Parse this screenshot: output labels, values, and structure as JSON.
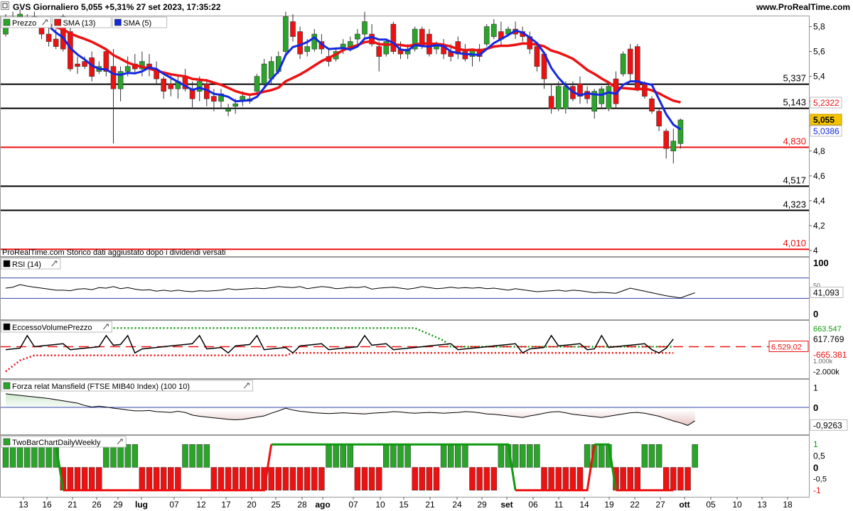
{
  "header": {
    "title": "GVS Giornaliero 5,055 +5,31% 27 set 2023, 17:35:22",
    "site": "www.ProRealTime.com"
  },
  "colors": {
    "up": "#2aa52a",
    "down": "#ee1111",
    "sma13": "#ee1111",
    "sma5": "#1428e0",
    "level_red": "#ee1111",
    "level_black": "#000000"
  },
  "chart_data": [
    {
      "type": "candlestick",
      "panel": "price",
      "title_badges": [
        "Prezzo",
        "SMA (13)",
        "SMA (5)"
      ],
      "note": "ProRealTime.com Storico dati aggiustato dopo i dividendi versati",
      "y_ticks": [
        "5,8",
        "5,6",
        "5,4",
        "5,2",
        "5",
        "4,8",
        "4,6",
        "4,4",
        "4,2",
        "4"
      ],
      "ylim": [
        4.0,
        5.9
      ],
      "levels": [
        {
          "value": 5.337,
          "label": "5,337",
          "color": "black"
        },
        {
          "value": 5.143,
          "label": "5,143",
          "color": "black"
        },
        {
          "value": 4.83,
          "label": "4,830",
          "color": "red"
        },
        {
          "value": 4.517,
          "label": "4,517",
          "color": "black"
        },
        {
          "value": 4.323,
          "label": "4,323",
          "color": "black"
        },
        {
          "value": 4.01,
          "label": "4,010",
          "color": "red"
        }
      ],
      "last_labels": [
        {
          "value": 5.2322,
          "label": "5,2322",
          "color": "#ee1111"
        },
        {
          "value": 5.055,
          "label": "5,055",
          "color": "#f5c400"
        },
        {
          "value": 5.0386,
          "label": "5,0386",
          "color": "#1428e0"
        }
      ],
      "candles": [
        [
          5.74,
          5.9,
          5.72,
          5.86
        ],
        [
          5.87,
          5.92,
          5.82,
          5.85
        ],
        [
          5.88,
          5.94,
          5.84,
          5.9
        ],
        [
          5.86,
          5.9,
          5.8,
          5.82
        ],
        [
          5.84,
          5.92,
          5.82,
          5.88
        ],
        [
          5.86,
          5.88,
          5.7,
          5.74
        ],
        [
          5.74,
          5.8,
          5.64,
          5.68
        ],
        [
          5.7,
          5.78,
          5.62,
          5.64
        ],
        [
          5.88,
          5.9,
          5.6,
          5.62
        ],
        [
          5.76,
          5.8,
          5.44,
          5.46
        ],
        [
          5.5,
          5.56,
          5.42,
          5.48
        ],
        [
          5.52,
          5.56,
          5.46,
          5.48
        ],
        [
          5.55,
          5.6,
          5.36,
          5.4
        ],
        [
          5.44,
          5.52,
          5.42,
          5.48
        ],
        [
          5.6,
          5.62,
          5.4,
          5.44
        ],
        [
          5.48,
          5.62,
          4.86,
          5.3
        ],
        [
          5.3,
          5.48,
          5.2,
          5.44
        ],
        [
          5.44,
          5.56,
          5.4,
          5.48
        ],
        [
          5.5,
          5.58,
          5.42,
          5.46
        ],
        [
          5.46,
          5.6,
          5.4,
          5.52
        ],
        [
          5.5,
          5.58,
          5.4,
          5.46
        ],
        [
          5.44,
          5.52,
          5.34,
          5.38
        ],
        [
          5.38,
          5.4,
          5.22,
          5.28
        ],
        [
          5.34,
          5.42,
          5.24,
          5.3
        ],
        [
          5.3,
          5.4,
          5.22,
          5.36
        ],
        [
          5.4,
          5.46,
          5.28,
          5.3
        ],
        [
          5.3,
          5.36,
          5.14,
          5.22
        ],
        [
          5.28,
          5.4,
          5.2,
          5.36
        ],
        [
          5.34,
          5.38,
          5.16,
          5.22
        ],
        [
          5.24,
          5.3,
          5.12,
          5.2
        ],
        [
          5.2,
          5.3,
          5.14,
          5.26
        ],
        [
          5.12,
          5.18,
          5.08,
          5.14
        ],
        [
          5.16,
          5.22,
          5.1,
          5.18
        ],
        [
          5.2,
          5.28,
          5.16,
          5.24
        ],
        [
          5.2,
          5.26,
          5.18,
          5.22
        ],
        [
          5.28,
          5.42,
          5.26,
          5.4
        ],
        [
          5.34,
          5.54,
          5.32,
          5.5
        ],
        [
          5.38,
          5.56,
          5.34,
          5.52
        ],
        [
          5.44,
          5.6,
          5.42,
          5.56
        ],
        [
          5.6,
          5.92,
          5.58,
          5.88
        ],
        [
          5.84,
          5.9,
          5.68,
          5.72
        ],
        [
          5.76,
          5.8,
          5.54,
          5.58
        ],
        [
          5.6,
          5.7,
          5.56,
          5.64
        ],
        [
          5.62,
          5.78,
          5.6,
          5.74
        ],
        [
          5.68,
          5.74,
          5.58,
          5.62
        ],
        [
          5.56,
          5.62,
          5.48,
          5.52
        ],
        [
          5.54,
          5.62,
          5.52,
          5.6
        ],
        [
          5.62,
          5.7,
          5.58,
          5.66
        ],
        [
          5.64,
          5.72,
          5.6,
          5.68
        ],
        [
          5.7,
          5.78,
          5.66,
          5.74
        ],
        [
          5.74,
          5.92,
          5.7,
          5.84
        ],
        [
          5.74,
          5.82,
          5.64,
          5.66
        ],
        [
          5.64,
          5.68,
          5.44,
          5.56
        ],
        [
          5.58,
          5.7,
          5.56,
          5.68
        ],
        [
          5.82,
          5.84,
          5.58,
          5.6
        ],
        [
          5.62,
          5.68,
          5.54,
          5.58
        ],
        [
          5.58,
          5.66,
          5.54,
          5.62
        ],
        [
          5.62,
          5.8,
          5.6,
          5.78
        ],
        [
          5.78,
          5.8,
          5.62,
          5.64
        ],
        [
          5.74,
          5.78,
          5.56,
          5.58
        ],
        [
          5.62,
          5.68,
          5.58,
          5.64
        ],
        [
          5.64,
          5.7,
          5.54,
          5.58
        ],
        [
          5.6,
          5.66,
          5.52,
          5.56
        ],
        [
          5.68,
          5.72,
          5.54,
          5.58
        ],
        [
          5.6,
          5.66,
          5.52,
          5.54
        ],
        [
          5.56,
          5.62,
          5.48,
          5.62
        ],
        [
          5.62,
          5.66,
          5.52,
          5.56
        ],
        [
          5.66,
          5.82,
          5.64,
          5.8
        ],
        [
          5.72,
          5.86,
          5.7,
          5.82
        ],
        [
          5.76,
          5.84,
          5.64,
          5.7
        ],
        [
          5.74,
          5.8,
          5.72,
          5.78
        ],
        [
          5.78,
          5.84,
          5.7,
          5.74
        ],
        [
          5.76,
          5.8,
          5.68,
          5.72
        ],
        [
          5.72,
          5.76,
          5.58,
          5.62
        ],
        [
          5.64,
          5.66,
          5.44,
          5.48
        ],
        [
          5.58,
          5.6,
          5.3,
          5.38
        ],
        [
          5.24,
          5.34,
          5.1,
          5.14
        ],
        [
          5.14,
          5.36,
          5.12,
          5.32
        ],
        [
          5.14,
          5.36,
          5.1,
          5.32
        ],
        [
          5.32,
          5.36,
          5.2,
          5.22
        ],
        [
          5.34,
          5.4,
          5.18,
          5.24
        ],
        [
          5.28,
          5.32,
          5.18,
          5.22
        ],
        [
          5.12,
          5.3,
          5.06,
          5.28
        ],
        [
          5.18,
          5.32,
          5.14,
          5.3
        ],
        [
          5.14,
          5.36,
          5.12,
          5.32
        ],
        [
          5.38,
          5.44,
          5.14,
          5.18
        ],
        [
          5.42,
          5.6,
          5.4,
          5.58
        ],
        [
          5.62,
          5.66,
          5.36,
          5.42
        ],
        [
          5.64,
          5.66,
          5.28,
          5.3
        ],
        [
          5.34,
          5.36,
          5.22,
          5.24
        ],
        [
          5.22,
          5.24,
          5.1,
          5.12
        ],
        [
          5.12,
          5.14,
          4.96,
          5.0
        ],
        [
          4.96,
          4.98,
          4.74,
          4.82
        ],
        [
          4.8,
          4.98,
          4.7,
          4.88
        ],
        [
          4.86,
          5.06,
          4.82,
          5.05
        ]
      ]
    },
    {
      "type": "line",
      "panel": "rsi",
      "title_badges": [
        "RSI (14)"
      ],
      "y_ticks": [
        "100",
        "50",
        "41,093",
        "0"
      ],
      "ylim": [
        0,
        100
      ],
      "bands": [
        70,
        30
      ],
      "last": "41,093",
      "values": [
        50,
        52,
        57,
        54,
        52,
        50,
        48,
        46,
        46,
        45,
        48,
        49,
        47,
        51,
        50,
        53,
        49,
        51,
        48,
        46,
        47,
        44,
        46,
        44,
        46,
        44,
        43,
        45,
        44,
        45,
        46,
        49,
        47,
        48,
        49,
        50,
        49,
        51,
        53,
        52,
        51,
        53,
        49,
        51,
        53,
        52,
        49,
        50,
        52,
        51,
        53,
        48,
        50,
        51,
        52,
        50,
        48,
        50,
        53,
        51,
        49,
        50,
        52,
        50,
        51,
        50,
        51,
        49,
        50,
        48,
        46,
        49,
        47,
        45,
        43,
        44,
        45,
        46,
        44,
        46,
        45,
        43,
        41,
        42,
        41,
        40,
        45,
        50,
        47,
        44,
        41,
        38,
        35,
        33,
        31,
        36,
        41
      ]
    },
    {
      "type": "line",
      "panel": "eccesso",
      "title_badges": [
        "EccessoVolumePrezzo"
      ],
      "y_ticks": [
        "663.547",
        "617.769",
        "-665.381",
        "1.000k",
        "-2.000k"
      ],
      "ylim": [
        -2200,
        1800
      ],
      "last_badge": "6.529,02",
      "upper_dotted_end": 663.547,
      "lower_dotted_end": -665.381,
      "oscillator_last": 617.769
    },
    {
      "type": "area",
      "panel": "mansfield",
      "title_badges": [
        "Forza relat Mansfield (FTSE MIB40 Index) (100 10)"
      ],
      "y_ticks": [
        "1",
        "0",
        "-0,9263"
      ],
      "ylim": [
        -1.1,
        1.1
      ],
      "last": "-0,9263",
      "values": [
        0.7,
        0.66,
        0.62,
        0.58,
        0.54,
        0.5,
        0.46,
        0.4,
        0.34,
        0.28,
        0.22,
        0.1,
        0.02,
        0.06,
        0.02,
        -0.04,
        -0.08,
        -0.14,
        -0.18,
        -0.18,
        -0.16,
        -0.22,
        -0.24,
        -0.26,
        -0.2,
        -0.26,
        -0.4,
        -0.46,
        -0.5,
        -0.54,
        -0.58,
        -0.62,
        -0.64,
        -0.62,
        -0.56,
        -0.5,
        -0.44,
        -0.3,
        -0.18,
        -0.04,
        -0.14,
        -0.2,
        -0.24,
        -0.28,
        -0.3,
        -0.32,
        -0.3,
        -0.28,
        -0.3,
        -0.32,
        -0.34,
        -0.3,
        -0.28,
        -0.26,
        -0.22,
        -0.24,
        -0.28,
        -0.3,
        -0.28,
        -0.26,
        -0.28,
        -0.3,
        -0.28,
        -0.26,
        -0.22,
        -0.24,
        -0.28,
        -0.34,
        -0.36,
        -0.4,
        -0.44,
        -0.48,
        -0.52,
        -0.44,
        -0.38,
        -0.3,
        -0.24,
        -0.22,
        -0.28,
        -0.36,
        -0.4,
        -0.44,
        -0.48,
        -0.52,
        -0.46,
        -0.4,
        -0.34,
        -0.28,
        -0.26,
        -0.3,
        -0.38,
        -0.46,
        -0.58,
        -0.7,
        -0.8,
        -0.93,
        -0.7
      ]
    },
    {
      "type": "bar",
      "panel": "twobar",
      "title_badges": [
        "TwoBarChartDailyWeekly"
      ],
      "y_ticks": [
        "1",
        "0,5",
        "0",
        "-0,5",
        "-1"
      ],
      "ylim": [
        -1.1,
        1.1
      ],
      "signals": [
        1,
        1,
        1,
        1,
        1,
        1,
        1,
        1,
        -1,
        -1,
        -1,
        -1,
        -1,
        -1,
        1,
        1,
        1,
        1,
        1,
        -1,
        -1,
        -1,
        -1,
        -1,
        -1,
        1,
        1,
        1,
        1,
        -1,
        -1,
        -1,
        -1,
        -1,
        -1,
        -1,
        -1,
        -1,
        -1,
        -1,
        -1,
        -1,
        -1,
        -1,
        -1,
        1,
        1,
        1,
        1,
        -1,
        -1,
        -1,
        -1,
        1,
        1,
        1,
        1,
        -1,
        -1,
        -1,
        -1,
        1,
        1,
        1,
        1,
        -1,
        -1,
        -1,
        -1,
        1,
        1,
        1,
        1,
        1,
        1,
        -1,
        -1,
        -1,
        -1,
        -1,
        -1,
        1,
        1,
        1,
        1,
        -1,
        -1,
        -1,
        -1,
        1,
        1,
        1,
        -1,
        -1,
        -1,
        -1,
        1
      ],
      "weekly": "green from x=378 to x=720 and x=835 to x=860; red elsewhere"
    }
  ],
  "x_axis": {
    "labels": [
      {
        "x": 33,
        "text": "13"
      },
      {
        "x": 66,
        "text": "16"
      },
      {
        "x": 102,
        "text": "21"
      },
      {
        "x": 136,
        "text": "26"
      },
      {
        "x": 166,
        "text": "29"
      },
      {
        "x": 199,
        "text": "lug",
        "bold": true
      },
      {
        "x": 245,
        "text": "07"
      },
      {
        "x": 283,
        "text": "12"
      },
      {
        "x": 318,
        "text": "17"
      },
      {
        "x": 354,
        "text": "20"
      },
      {
        "x": 388,
        "text": "25"
      },
      {
        "x": 425,
        "text": "28"
      },
      {
        "x": 454,
        "text": "ago",
        "bold": true
      },
      {
        "x": 497,
        "text": "07"
      },
      {
        "x": 535,
        "text": "10"
      },
      {
        "x": 568,
        "text": "15"
      },
      {
        "x": 605,
        "text": "21"
      },
      {
        "x": 643,
        "text": "24"
      },
      {
        "x": 678,
        "text": "29"
      },
      {
        "x": 713,
        "text": "set",
        "bold": true
      },
      {
        "x": 750,
        "text": "06"
      },
      {
        "x": 786,
        "text": "11"
      },
      {
        "x": 822,
        "text": "14"
      },
      {
        "x": 857,
        "text": "19"
      },
      {
        "x": 893,
        "text": "22"
      },
      {
        "x": 929,
        "text": "27"
      },
      {
        "x": 963,
        "text": "ott",
        "bold": true
      },
      {
        "x": 1000,
        "text": "05"
      },
      {
        "x": 1037,
        "text": "10"
      },
      {
        "x": 1072,
        "text": "13"
      },
      {
        "x": 1108,
        "text": "18"
      }
    ]
  }
}
